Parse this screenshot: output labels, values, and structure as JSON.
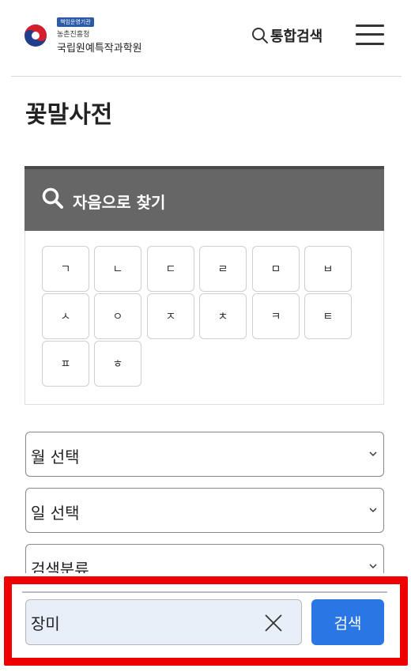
{
  "header": {
    "logo_badge": "책임운영기관",
    "logo_line1": "농촌진흥청",
    "logo_line2": "국립원예특작과학원",
    "search_label": "통합검색",
    "icons": {
      "search": "search-icon",
      "menu": "hamburger-menu-icon"
    }
  },
  "page": {
    "title": "꽃말사전"
  },
  "initial_search": {
    "heading": "자음으로 찾기",
    "consonants": [
      "ㄱ",
      "ㄴ",
      "ㄷ",
      "ㄹ",
      "ㅁ",
      "ㅂ",
      "ㅅ",
      "ㅇ",
      "ㅈ",
      "ㅊ",
      "ㅋ",
      "ㅌ",
      "ㅍ",
      "ㅎ"
    ]
  },
  "filters": {
    "month": "월 선택",
    "day": "일 선택",
    "category": "검색분류"
  },
  "search": {
    "value": "장미",
    "button_label": "검색"
  },
  "colors": {
    "panel_header": "#666666",
    "search_button": "#2b76e5",
    "highlight_frame": "#ee0000",
    "input_background": "#e9eff9"
  }
}
